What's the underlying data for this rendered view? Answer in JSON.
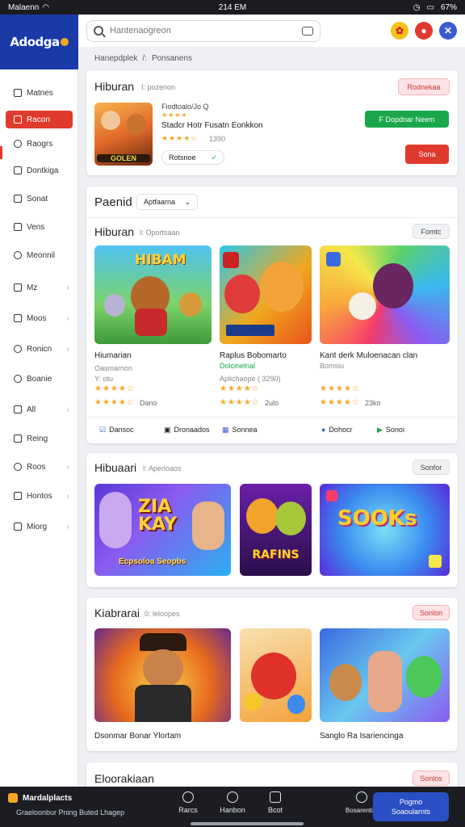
{
  "status_bar": {
    "carrier": "Malaenn",
    "time": "214 EM",
    "battery": "67%"
  },
  "brand": {
    "logo_text": "Adodga"
  },
  "search": {
    "placeholder": "Hantenaogreon"
  },
  "breadcrumb": {
    "part1": "Hanepdplek",
    "separator": "/:",
    "part2": "Ponsanens"
  },
  "sidebar": {
    "items": [
      {
        "label": "Matnes",
        "icon": "inbox-icon"
      },
      {
        "label": "Racon",
        "icon": "store-icon",
        "active": true
      },
      {
        "label": "Raogrs",
        "icon": "clock-icon"
      },
      {
        "label": "Dontkiga",
        "icon": "wallet-icon"
      },
      {
        "label": "Sonat",
        "icon": "doc-icon"
      },
      {
        "label": "Vens",
        "icon": "grid-icon"
      },
      {
        "label": "Meonnil",
        "icon": "user-icon"
      },
      {
        "label": "Mz",
        "icon": "card-icon"
      },
      {
        "label": "Moos",
        "icon": "calendar-icon"
      },
      {
        "label": "Ronicn",
        "icon": "bell-icon"
      },
      {
        "label": "Boanie",
        "icon": "gear-icon"
      },
      {
        "label": "All",
        "icon": "users-icon"
      },
      {
        "label": "Reing",
        "icon": "tag-icon"
      },
      {
        "label": "Roos",
        "icon": "heart-icon"
      },
      {
        "label": "Hontos",
        "icon": "flag-icon"
      },
      {
        "label": "Miorg",
        "icon": "list-icon"
      }
    ]
  },
  "featured": {
    "title": "Hiburan",
    "subtitle": "I: pozenon",
    "tag": "Rodnekaa",
    "app_title": "Fiodtoalo/Jo Q",
    "description": "Stadcr Hotr Fusatn Eonkkon",
    "rating_text": "1390",
    "rating_pill": "Rotsnoe",
    "primary_label": "F Dopdnar Neem",
    "secondary_label": "Sona",
    "thumb_caption": "GOLEN"
  },
  "section2": {
    "heading": "Paenid",
    "dropdown": "Aptfaarna",
    "sub_heading": "Hiburan",
    "sub_meta": "I: Oportsaan",
    "more": "Fomtc",
    "games": [
      {
        "title": "Hiumarian",
        "meta": "Oasmarnon",
        "meta2": "Y: otu",
        "rating": "Dano",
        "banner": "HIBAM"
      },
      {
        "title": "Raplus Bobomarto",
        "meta": "Dolcinelnal",
        "meta2": "Aplichaope ( 3290)",
        "rating": "2ulo"
      },
      {
        "title": "Kant derk Muloenacan clan",
        "meta": "Bomsiu",
        "meta2": "",
        "rating": "23ko"
      }
    ],
    "actions": [
      "Dansoc",
      "Dronaados",
      "Sonnea",
      "Dohocr",
      "Sonoi"
    ]
  },
  "section3": {
    "heading": "Hibuaari",
    "subtitle": "I: Aperloaos",
    "more": "Sonfor",
    "banners": [
      "ZIA KAY",
      "RAFINS",
      "SOOKs"
    ],
    "banner_caption": "Ecpsoloa Seopbs"
  },
  "section4": {
    "heading": "Kiabrarai",
    "subtitle": "0: leloopes",
    "more": "Sonlon",
    "captions": [
      "Dsonmar Bonar Ylortam",
      "Sanglo Ra Isariencinga"
    ]
  },
  "section5": {
    "heading": "Eloorakiaan",
    "more": "Sonlos"
  },
  "bottom_nav": {
    "badge": "Mardalplacts",
    "caption": "Graeloonbur Pning Buted Lhagep",
    "items": [
      "Rarcs",
      "Hanbon",
      "Bcot",
      "Bosarentilo"
    ],
    "cta_line1": "Pogmo",
    "cta_line2": "Soaoularnts"
  },
  "colors": {
    "accent_red": "#e03a2f",
    "brand_blue": "#1a3aa8",
    "success_green": "#1aa74a",
    "star_yellow": "#f5a623"
  }
}
